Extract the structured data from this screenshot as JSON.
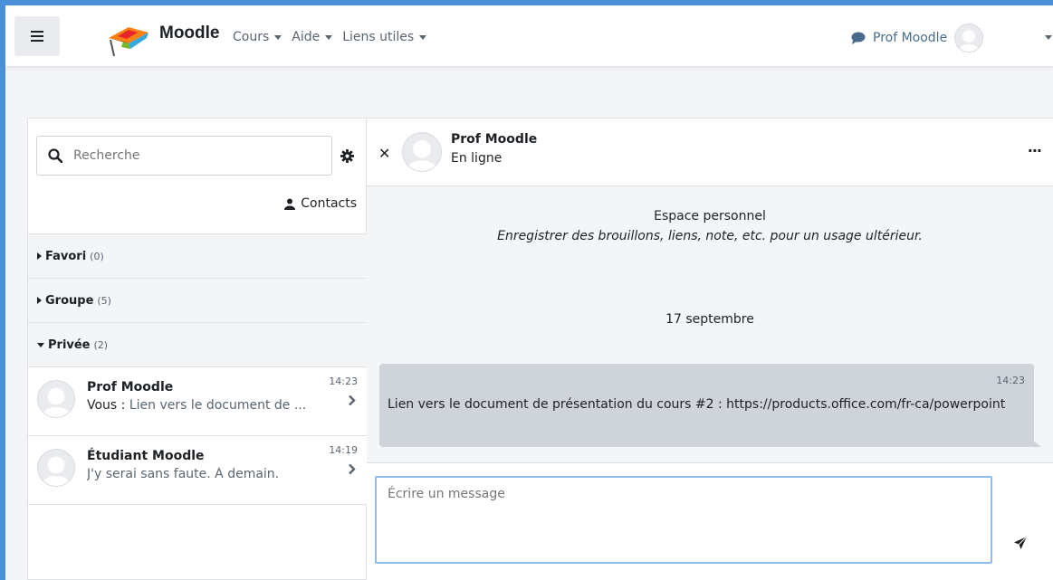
{
  "navbar": {
    "brand": "Moodle",
    "menu": [
      {
        "label": "Cours"
      },
      {
        "label": "Aide"
      },
      {
        "label": "Liens utiles"
      }
    ],
    "user_name": "Prof Moodle"
  },
  "sidebar": {
    "search_placeholder": "Recherche",
    "contacts_label": "Contacts",
    "sections": [
      {
        "label": "Favori",
        "count": "(0)"
      },
      {
        "label": "Groupe",
        "count": "(5)"
      },
      {
        "label": "Privée",
        "count": "(2)"
      }
    ],
    "conversations": [
      {
        "name": "Prof Moodle",
        "time": "14:23",
        "prefix": "Vous : ",
        "preview": "Lien vers le document de ..."
      },
      {
        "name": "Étudiant Moodle",
        "time": "14:19",
        "prefix": "",
        "preview": "J'y serai sans faute. À demain."
      }
    ]
  },
  "chat": {
    "name": "Prof Moodle",
    "status": "En ligne",
    "more_label": "···",
    "space_title": "Espace personnel",
    "space_desc": "Enregistrer des brouillons, liens, note, etc. pour un usage ultérieur.",
    "date": "17 septembre",
    "message": {
      "time": "14:23",
      "text": "Lien vers le document de présentation du cours #2 : https://products.office.com/fr-ca/powerpoint"
    },
    "compose_placeholder": "Écrire un message"
  },
  "colors": {
    "accent_blue": "#4a90d9",
    "bubble": "#ced4da",
    "link_blue": "#4a6c8c"
  }
}
